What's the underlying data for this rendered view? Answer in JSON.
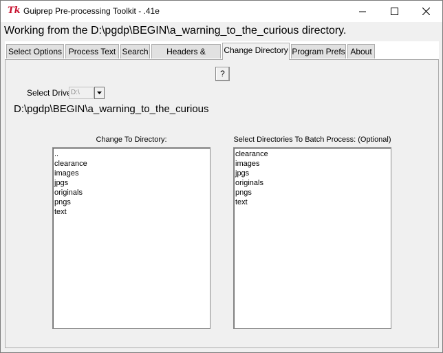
{
  "window": {
    "title": "Guiprep Pre-processing Toolkit - .41e",
    "app_icon": "tk-feather-icon",
    "controls": [
      "minimize-icon",
      "maximize-icon",
      "close-icon"
    ]
  },
  "status": {
    "text": "Working from the D:\\pgdp\\BEGIN\\a_warning_to_the_curious directory."
  },
  "tabs": [
    {
      "label": "Select Options",
      "active": false
    },
    {
      "label": "Process Text",
      "active": false
    },
    {
      "label": "Search",
      "active": false
    },
    {
      "label": "Headers & Footers",
      "active": false
    },
    {
      "label": "Change Directory",
      "active": true
    },
    {
      "label": "Program Prefs",
      "active": false
    },
    {
      "label": "About",
      "active": false
    }
  ],
  "page": {
    "help_label": "?",
    "drive_label": "Select Drive",
    "drive_value": "D:\\",
    "current_path": "D:\\pgdp\\BEGIN\\a_warning_to_the_curious",
    "change_dir": {
      "caption": "Change To Directory:",
      "items": [
        "..",
        "clearance",
        "images",
        "jpgs",
        "originals",
        "pngs",
        "text"
      ]
    },
    "batch": {
      "caption": "Select Directories To Batch Process: (Optional)",
      "items": [
        "clearance",
        "images",
        "jpgs",
        "originals",
        "pngs",
        "text"
      ]
    }
  }
}
